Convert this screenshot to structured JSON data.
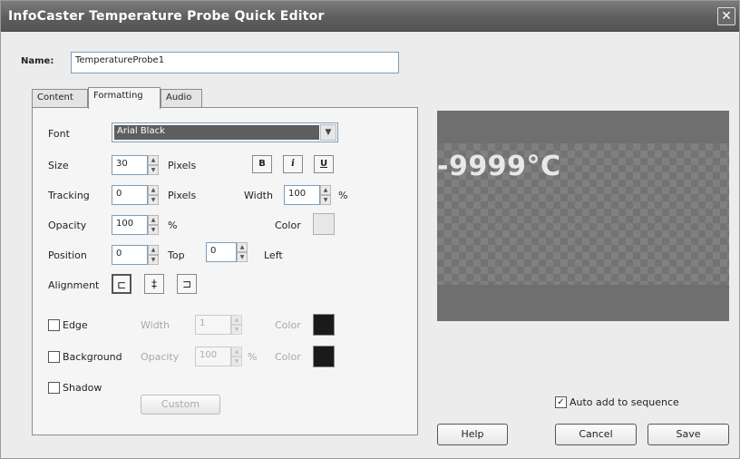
{
  "window": {
    "title": "InfoCaster Temperature Probe Quick Editor",
    "close_glyph": "✕"
  },
  "name_field": {
    "label": "Name:",
    "value": "TemperatureProbe1"
  },
  "tabs": [
    {
      "label": "Content"
    },
    {
      "label": "Formatting",
      "active": true
    },
    {
      "label": "Audio"
    }
  ],
  "formatting": {
    "font": {
      "label": "Font",
      "value": "Arial Black"
    },
    "size": {
      "label": "Size",
      "value": "30",
      "unit": "Pixels"
    },
    "style_buttons": {
      "bold": "B",
      "italic": "i",
      "underline": "U"
    },
    "tracking": {
      "label": "Tracking",
      "value": "0",
      "unit": "Pixels"
    },
    "width": {
      "label": "Width",
      "value": "100",
      "unit": "%"
    },
    "opacity": {
      "label": "Opacity",
      "value": "100",
      "unit": "%"
    },
    "color": {
      "label": "Color",
      "swatch": "#e8e8e8"
    },
    "position": {
      "label": "Position",
      "top_value": "0",
      "top_label": "Top",
      "left_value": "0",
      "left_label": "Left"
    },
    "alignment": {
      "label": "Alignment",
      "buttons": [
        "left-align-icon",
        "center-align-icon",
        "right-align-icon"
      ]
    },
    "edge": {
      "label": "Edge",
      "checked": false,
      "width_label": "Width",
      "width_value": "1",
      "color_label": "Color",
      "color": "#1a1a1a"
    },
    "background": {
      "label": "Background",
      "checked": false,
      "opacity_label": "Opacity",
      "opacity_value": "100",
      "unit": "%",
      "color_label": "Color",
      "color": "#1a1a1a"
    },
    "shadow": {
      "label": "Shadow",
      "checked": false,
      "custom_button": "Custom"
    }
  },
  "preview": {
    "text": "-9999°C"
  },
  "footer": {
    "auto_add": {
      "label": "Auto add to sequence",
      "checked": true
    },
    "help": "Help",
    "cancel": "Cancel",
    "save": "Save"
  }
}
